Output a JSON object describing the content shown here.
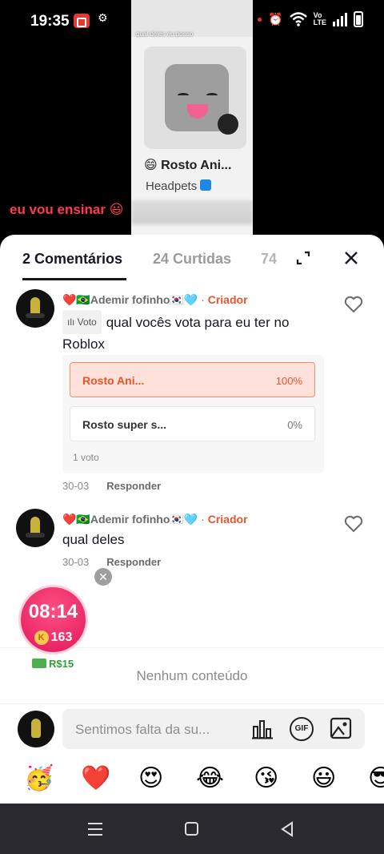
{
  "status_bar": {
    "time": "19:35",
    "icons": [
      "video-record-icon",
      "gear-icon",
      "red-dot",
      "alarm-icon",
      "wifi-icon",
      "volte-icon",
      "signal-icon",
      "battery-icon"
    ]
  },
  "video": {
    "preview_caption": "qual deles eu posso",
    "preview_title": "😄 Rosto Ani...",
    "preview_subtitle": "Headpets",
    "overlay_caption": "eu vou ensinar 😃"
  },
  "tabs": {
    "comments": "2 Comentários",
    "likes": "24 Curtidas",
    "more": "74"
  },
  "comments": [
    {
      "username": "❤️🇧🇷Ademir fofinho🇰🇷🩵",
      "role": "Criador",
      "vote_tag": "Voto",
      "text": "qual vocês vota para eu ter no Roblox",
      "poll": {
        "options": [
          {
            "label": "Rosto Ani...",
            "percent": "100%"
          },
          {
            "label": "Rosto super s...",
            "percent": "0%"
          }
        ],
        "count": "1 voto"
      },
      "date": "30-03",
      "reply": "Responder"
    },
    {
      "username": "❤️🇧🇷Ademir fofinho🇰🇷🩵",
      "role": "Criador",
      "text": "qual deles",
      "date": "30-03",
      "reply": "Responder"
    }
  ],
  "timer_widget": {
    "time": "08:14",
    "coins": "163",
    "reward": "R$15"
  },
  "empty_state": "Nenhum conteúdo",
  "input": {
    "placeholder": "Sentimos falta da su..."
  },
  "emojis": [
    "🥳",
    "❤️",
    "😍",
    "😂",
    "😘",
    "😃",
    "😎"
  ],
  "colors": {
    "accent": "#e6552e",
    "timer": "#e0185a"
  }
}
